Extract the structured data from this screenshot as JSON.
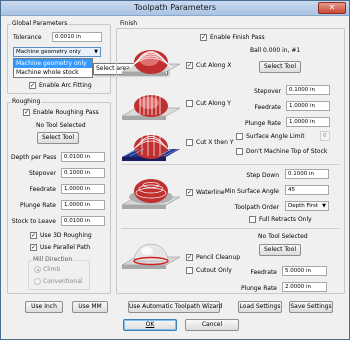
{
  "window": {
    "title": "Toolpath Parameters",
    "close_glyph": "✕"
  },
  "global": {
    "group_label": "Global Parameters",
    "tolerance_label": "Tolerance",
    "tolerance_value": "0.0010 in",
    "geometry_selected": "Machine geometry only",
    "geometry_options": [
      "Machine geometry only",
      "Machine whole stock"
    ],
    "tooltip": "Select area to machine",
    "arc_fitting_label": "Enable Arc Fitting",
    "arc_fitting_checked": true
  },
  "roughing": {
    "group_label": "Roughing",
    "enable_label": "Enable Roughing Pass",
    "enable_checked": true,
    "tool_status": "No Tool Selected",
    "select_tool_label": "Select Tool",
    "depth_label": "Depth per Pass",
    "depth_value": "0.0100 in",
    "stepover_label": "Stepover",
    "stepover_value": "0.1000 in",
    "feedrate_label": "Feedrate",
    "feedrate_value": "1.0000 in",
    "plunge_label": "Plunge Rate",
    "plunge_value": "1.0000 in",
    "stock_label": "Stock to Leave",
    "stock_value": "0.0100 in",
    "use3d_label": "Use 3D Roughing",
    "use3d_checked": true,
    "parallel_label": "Use Parallel Path",
    "parallel_checked": true,
    "mill_direction_label": "Mill Direction",
    "climb_label": "Climb",
    "conventional_label": "Conventional",
    "mill_direction_selected": "Climb"
  },
  "finish": {
    "group_label": "Finish",
    "enable_label": "Enable Finish Pass",
    "enable_checked": true,
    "tool_info": "Ball 0.000 in, #1",
    "select_tool_label": "Select Tool",
    "cut_x_label": "Cut Along X",
    "cut_x_checked": true,
    "cut_y_label": "Cut Along Y",
    "cut_y_checked": false,
    "cut_xy_label": "Cut X then Y",
    "cut_xy_checked": false,
    "stepover_label": "Stepover",
    "stepover_value": "0.1000 in",
    "feedrate_label": "Feedrate",
    "feedrate_value": "1.0000 in",
    "plunge_label": "Plunge Rate",
    "plunge_value": "1.0000 in",
    "surface_limit_label": "Surface Angle Limit",
    "surface_limit_checked": false,
    "surface_limit_value": "0",
    "dont_machine_label": "Don't Machine Top of Stock",
    "dont_machine_checked": false
  },
  "waterline": {
    "label": "Waterline",
    "checked": true,
    "step_down_label": "Step Down",
    "step_down_value": "0.1000 in",
    "min_angle_label": "Min Surface Angle",
    "min_angle_value": "45",
    "order_label": "Toolpath Order",
    "order_value": "Depth First",
    "full_retracts_label": "Full Retracts Only",
    "full_retracts_checked": false
  },
  "pencil": {
    "tool_status": "No Tool Selected",
    "cleanup_label": "Pencil Cleanup",
    "cleanup_checked": true,
    "cutout_label": "Cutout Only",
    "cutout_checked": false,
    "select_tool_label": "Select Tool",
    "feedrate_label": "Feedrate",
    "feedrate_value": "5.0000 in",
    "plunge_label": "Plunge Rate",
    "plunge_value": "2.0000 in"
  },
  "buttons": {
    "use_inch": "Use Inch",
    "use_mm": "Use MM",
    "wizard": "Use Automatic Toolpath Wizard",
    "load": "Load Settings",
    "save": "Save Settings",
    "ok": "OK",
    "cancel": "Cancel"
  },
  "icons": {
    "check": "✓",
    "dropdown_arrow": "▼",
    "radio": "radio-dot"
  }
}
